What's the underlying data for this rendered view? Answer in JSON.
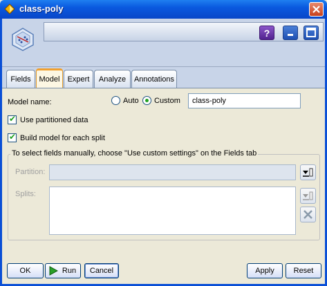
{
  "window": {
    "title": "class-poly"
  },
  "tabs": [
    "Fields",
    "Model",
    "Expert",
    "Analyze",
    "Annotations"
  ],
  "model": {
    "name_label": "Model name:",
    "auto_label": "Auto",
    "custom_label": "Custom",
    "name_value": "class-poly",
    "use_partitioned_label": "Use partitioned data",
    "build_each_split_label": "Build model for each split"
  },
  "fields_group": {
    "legend": "To select fields manually, choose \"Use custom settings\" on the Fields tab",
    "partition_label": "Partition:",
    "splits_label": "Splits:"
  },
  "buttons": {
    "ok": "OK",
    "run": "Run",
    "cancel": "Cancel",
    "apply": "Apply",
    "reset": "Reset"
  },
  "colors": {
    "titlebar": "#0a59df",
    "header": "#c8d4e8",
    "active_tab_accent": "#f0a030",
    "check_green": "#21a121"
  }
}
